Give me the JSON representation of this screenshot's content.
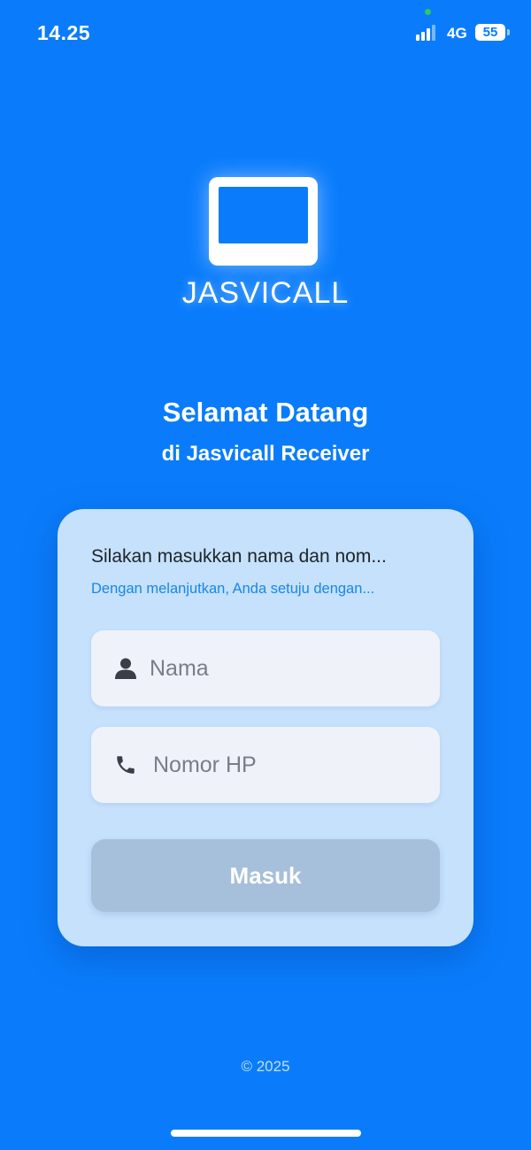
{
  "status_bar": {
    "time": "14.25",
    "network": "4G",
    "battery": "55",
    "signal_icon": "cellular-signal-icon",
    "battery_icon": "battery-icon"
  },
  "logo": {
    "icon": "monitor-screen-icon",
    "text": "JASVICALL"
  },
  "welcome": {
    "title": "Selamat Datang",
    "subtitle": "di Jasvicall Receiver"
  },
  "login_card": {
    "instruction": "Silakan masukkan nama dan nom...",
    "terms": "Dengan melanjutkan, Anda setuju dengan...",
    "name_field": {
      "placeholder": "Nama",
      "value": "",
      "icon": "user-icon"
    },
    "phone_field": {
      "placeholder": "Nomor HP",
      "value": "",
      "icon": "phone-icon"
    },
    "submit_label": "Masuk"
  },
  "footer": {
    "copyright": "© 2025"
  },
  "colors": {
    "background": "#0a7cfb",
    "card": "#c5e1fc",
    "field": "#eff2f9",
    "button_disabled": "#a6bfdb",
    "terms_link": "#1a86e6"
  }
}
